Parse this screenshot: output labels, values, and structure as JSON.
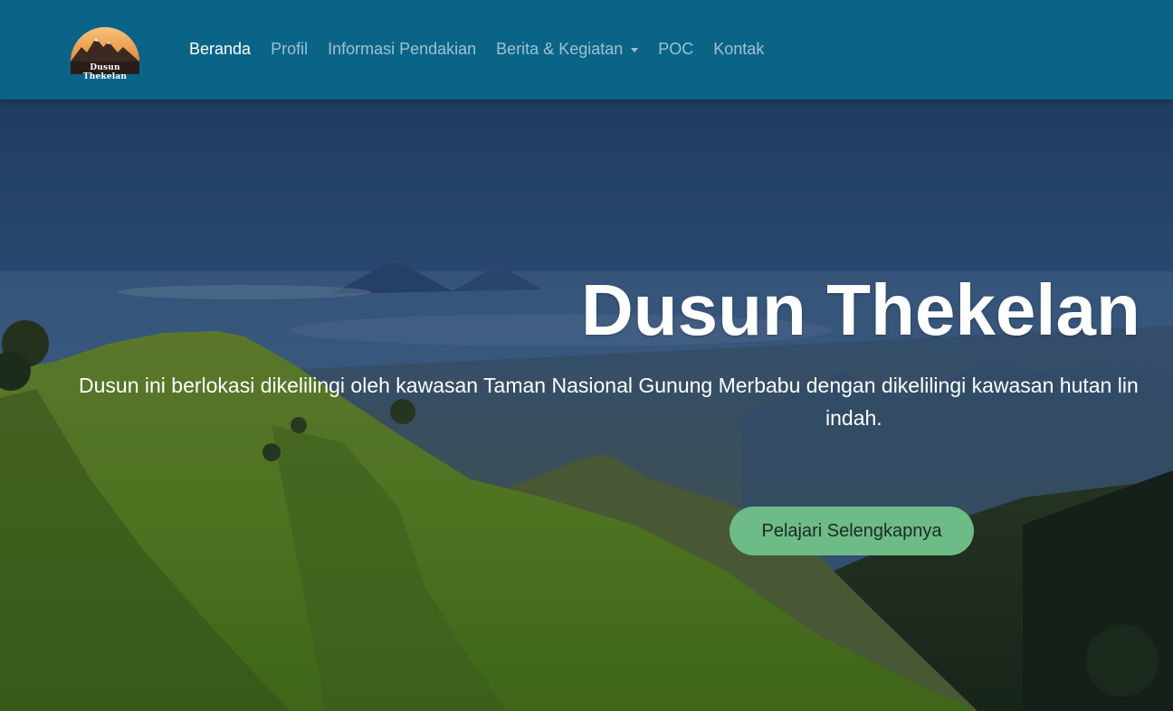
{
  "brand": {
    "logo_text": "Dusun Thekelan",
    "colors": {
      "navbar": "#0a6487",
      "cta": "#6dbb86"
    }
  },
  "nav": {
    "items": [
      {
        "label": "Beranda",
        "active": true
      },
      {
        "label": "Profil",
        "active": false
      },
      {
        "label": "Informasi Pendakian",
        "active": false
      },
      {
        "label": "Berita & Kegiatan",
        "active": false,
        "dropdown": true
      },
      {
        "label": "POC",
        "active": false
      },
      {
        "label": "Kontak",
        "active": false
      }
    ]
  },
  "hero": {
    "title": "Dusun Thekelan",
    "description_line1": "Dusun ini berlokasi dikelilingi oleh kawasan Taman Nasional Gunung Merbabu dengan dikelilingi kawasan hutan lin",
    "description_line2": "indah.",
    "cta_label": "Pelajari Selengkapnya",
    "background": "mountain-landscape"
  }
}
